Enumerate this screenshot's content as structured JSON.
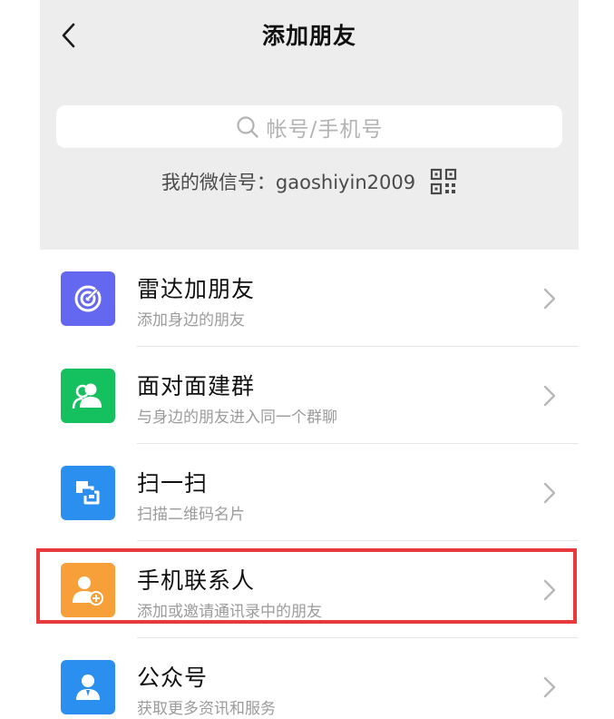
{
  "header": {
    "title": "添加朋友"
  },
  "search": {
    "placeholder": "帐号/手机号"
  },
  "wechat_id": {
    "text": "我的微信号：gaoshiyin2009"
  },
  "menu": [
    {
      "title": "雷达加朋友",
      "subtitle": "添加身边的朋友",
      "icon": "radar-icon",
      "color": "#6467f0"
    },
    {
      "title": "面对面建群",
      "subtitle": "与身边的朋友进入同一个群聊",
      "icon": "face-to-face-group-icon",
      "color": "#15c05f"
    },
    {
      "title": "扫一扫",
      "subtitle": "扫描二维码名片",
      "icon": "scan-icon",
      "color": "#2b8ff0"
    },
    {
      "title": "手机联系人",
      "subtitle": "添加或邀请通讯录中的朋友",
      "icon": "phone-contacts-icon",
      "color": "#f7a03a"
    },
    {
      "title": "公众号",
      "subtitle": "获取更多资讯和服务",
      "icon": "official-account-icon",
      "color": "#2b8ff0"
    }
  ],
  "highlight_color": "#e8393c"
}
